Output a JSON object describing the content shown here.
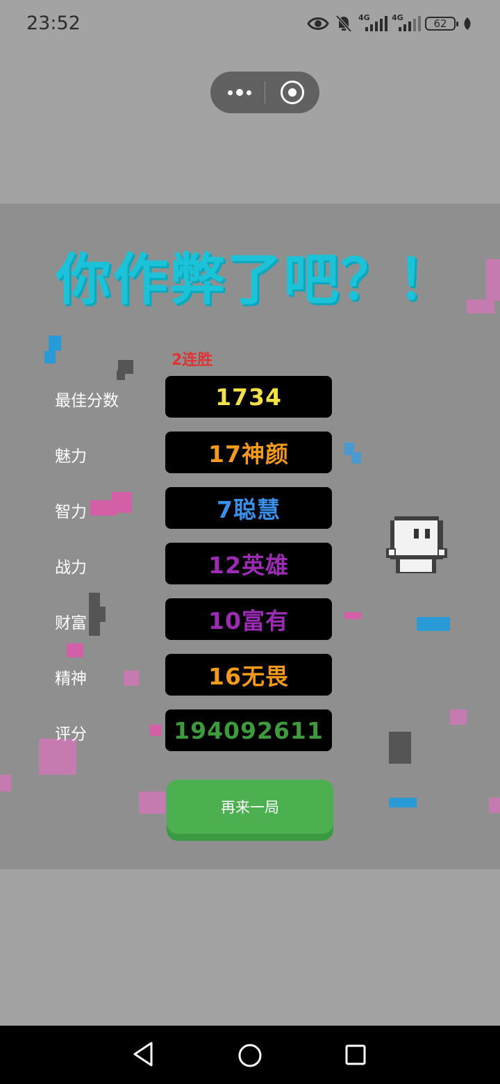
{
  "status_bar": {
    "time": "23:52",
    "network1": "4G",
    "network2": "4G",
    "battery": "62",
    "icons": [
      "eye-icon",
      "bell-off-icon",
      "signal-icon",
      "signal-icon",
      "battery-icon",
      "leaf-icon"
    ]
  },
  "capsule": {
    "more_icon": "more-icon",
    "close_icon": "target-icon"
  },
  "game": {
    "title": "你作弊了吧？！",
    "streak": "2连胜",
    "rows": [
      {
        "label": "最佳分数",
        "value": "1734",
        "color": "#f3e04a"
      },
      {
        "label": "魅力",
        "value": "17神颜",
        "color": "#f39a1c"
      },
      {
        "label": "智力",
        "value": "7聪慧",
        "color": "#3a8fe8"
      },
      {
        "label": "战力",
        "value": "12英雄",
        "color": "#9c2cb3"
      },
      {
        "label": "财富",
        "value": "10富有",
        "color": "#9c2cb3"
      },
      {
        "label": "精神",
        "value": "16无畏",
        "color": "#f39a1c"
      },
      {
        "label": "评分",
        "value": "194092611",
        "color": "#3d9a3d"
      }
    ],
    "again_button": "再来一局"
  },
  "nav": {
    "back": "back-icon",
    "home": "home-icon",
    "recents": "recents-icon"
  }
}
